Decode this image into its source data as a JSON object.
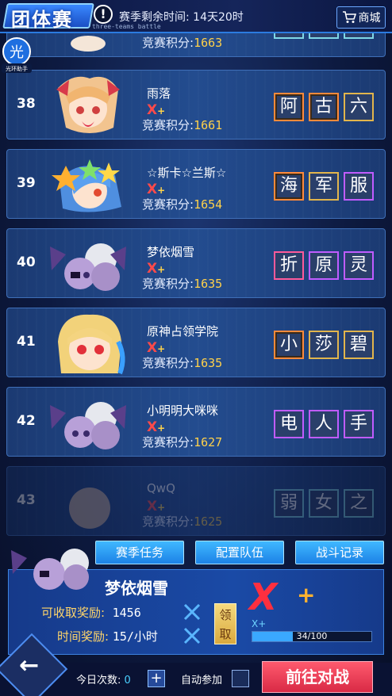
{
  "header": {
    "title": "团体赛",
    "subtitle_en": "three-teams battle",
    "season_time_label": "赛季剩余时间:",
    "season_time_value": "14天20时",
    "shop_label": "商城"
  },
  "assist_badge": {
    "char": "光",
    "label": "光环助手"
  },
  "rows": [
    {
      "rank": "",
      "name": "",
      "xplus": "",
      "score_label": "竞赛积分:",
      "score": "1663",
      "tags": [],
      "colors": []
    },
    {
      "rank": "38",
      "name": "雨落",
      "xplus": "X",
      "score_label": "竞赛积分:",
      "score": "1661",
      "tags": [
        "阿",
        "古",
        "六"
      ],
      "colors": [
        "orange",
        "orange",
        "gold"
      ]
    },
    {
      "rank": "39",
      "name": "☆斯卡☆兰斯☆",
      "xplus": "X",
      "score_label": "竞赛积分:",
      "score": "1654",
      "tags": [
        "海",
        "军",
        "服"
      ],
      "colors": [
        "orange",
        "gold",
        "purple"
      ]
    },
    {
      "rank": "40",
      "name": "梦依烟雪",
      "xplus": "X",
      "score_label": "竞赛积分:",
      "score": "1635",
      "tags": [
        "折",
        "原",
        "灵"
      ],
      "colors": [
        "pink",
        "purple",
        "purple"
      ]
    },
    {
      "rank": "41",
      "name": "原神占领学院",
      "xplus": "X",
      "score_label": "竞赛积分:",
      "score": "1635",
      "tags": [
        "小",
        "莎",
        "碧"
      ],
      "colors": [
        "orange",
        "gold",
        "gold"
      ]
    },
    {
      "rank": "42",
      "name": "小明明大咪咪",
      "xplus": "X",
      "score_label": "竞赛积分:",
      "score": "1627",
      "tags": [
        "电",
        "人",
        "手"
      ],
      "colors": [
        "purple",
        "purple",
        "purple"
      ]
    },
    {
      "rank": "43",
      "name": "QwQ",
      "xplus": "X",
      "score_label": "竞赛积分:",
      "score": "1625",
      "tags": [
        "弱",
        "女",
        "之"
      ],
      "colors": [
        "teal",
        "teal",
        "teal"
      ]
    }
  ],
  "buttons": {
    "season_task": "赛季任务",
    "configure_team": "配置队伍",
    "battle_record": "战斗记录"
  },
  "panel": {
    "player_name": "梦依烟雪",
    "claimable_label": "可收取奖励:",
    "claimable_value": "1456",
    "time_reward_label": "时间奖励:",
    "time_reward_value": "15/小时",
    "claim_label": "领取",
    "level_x": "X",
    "level_plus": "+",
    "level_small": "X+",
    "progress_text": "34/100",
    "progress_fraction": 0.34
  },
  "bottom": {
    "today_label": "今日次数:",
    "today_value": "0",
    "plus": "+",
    "auto_label": "自动参加",
    "go_label": "前往对战"
  },
  "colors": {
    "accent_blue": "#2b7be0",
    "score_gold": "#ffd14a",
    "go_red": "#d92a45",
    "x_red": "#ff2f3f"
  }
}
